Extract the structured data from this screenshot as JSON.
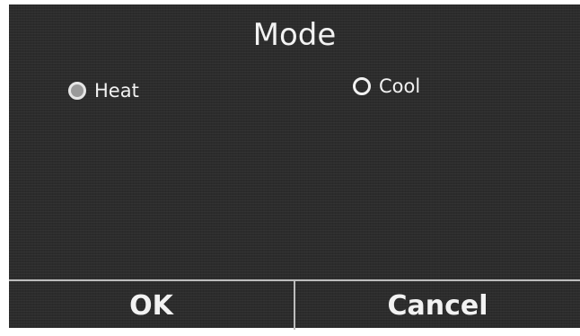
{
  "title": "Mode",
  "options": [
    {
      "label": "Heat",
      "selected": true
    },
    {
      "label": "Cool",
      "selected": false
    }
  ],
  "buttons": {
    "ok_label": "OK",
    "cancel_label": "Cancel"
  },
  "colors": {
    "background": "#2c2c2c",
    "text": "#f2f2f2",
    "selected_radio_fill": "#9a9a9a",
    "divider": "#bdbdbd"
  }
}
